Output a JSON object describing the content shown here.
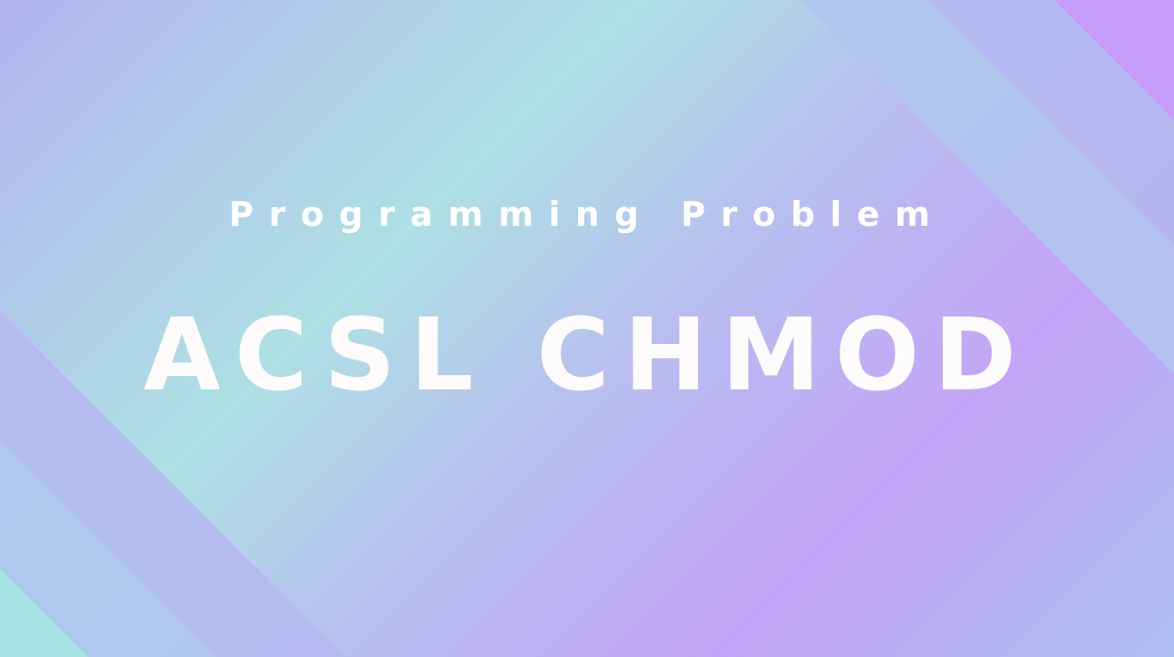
{
  "banner": {
    "subtitle": "Programming Problem",
    "title": "ACSL CHMOD"
  },
  "colors": {
    "text": "#ffffff",
    "lavender": "#c4a3f8",
    "mint": "#a8e4e3",
    "periwinkle": "#b5bcef"
  }
}
